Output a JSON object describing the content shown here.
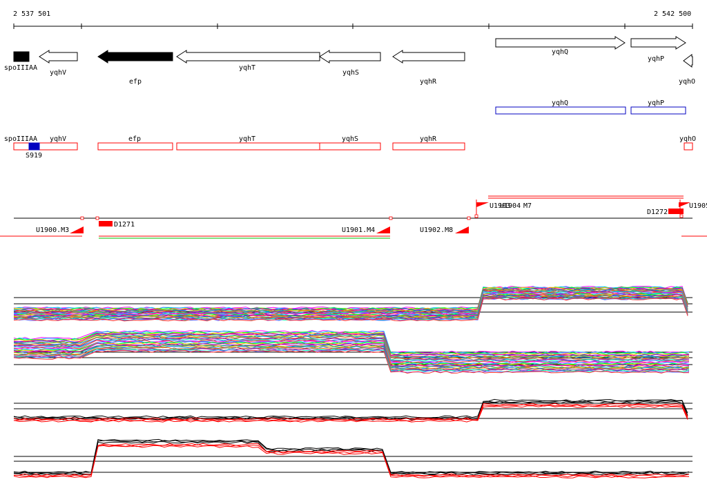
{
  "coords": {
    "left": "2 537 501",
    "right": "2 542 500"
  },
  "genes": [
    {
      "id": "spoIIIAA",
      "label": "spoIIIAA",
      "dir": "box",
      "filled": true
    },
    {
      "id": "yqhV",
      "label": "yqhV",
      "dir": "left",
      "filled": false
    },
    {
      "id": "efp",
      "label": "efp",
      "dir": "left",
      "filled": true
    },
    {
      "id": "yqhT",
      "label": "yqhT",
      "dir": "left",
      "filled": false
    },
    {
      "id": "yqhS",
      "label": "yqhS",
      "dir": "left",
      "filled": false
    },
    {
      "id": "yqhR",
      "label": "yqhR",
      "dir": "left",
      "filled": false
    },
    {
      "id": "yqhQ",
      "label": "yqhQ",
      "dir": "right",
      "filled": false
    },
    {
      "id": "yqhP",
      "label": "yqhP",
      "dir": "right",
      "filled": false
    },
    {
      "id": "yqhO",
      "label": "yqhO",
      "dir": "left",
      "filled": false
    }
  ],
  "blue_features": [
    {
      "label": "yqhQ"
    },
    {
      "label": "yqhP"
    }
  ],
  "red_features": [
    {
      "label": "spoIIIAA"
    },
    {
      "label": "yqhV"
    },
    {
      "label": "efp"
    },
    {
      "label": "yqhT"
    },
    {
      "label": "yqhS"
    },
    {
      "label": "yqhR"
    },
    {
      "label": "yqhO"
    }
  ],
  "site": {
    "label": "S919"
  },
  "regulatory": [
    {
      "label": "U1900.M3"
    },
    {
      "label": "D1271"
    },
    {
      "label": "U1901.M4"
    },
    {
      "label": "U1902.M8"
    },
    {
      "label": "U1903"
    },
    {
      "label": "U1904"
    },
    {
      "label": "D1272"
    },
    {
      "label": "U1905"
    }
  ],
  "overlap_label": "M7",
  "colors": {
    "red": "#ff0000",
    "blue": "#0000c0",
    "green": "#00c000",
    "line": "#000000"
  }
}
